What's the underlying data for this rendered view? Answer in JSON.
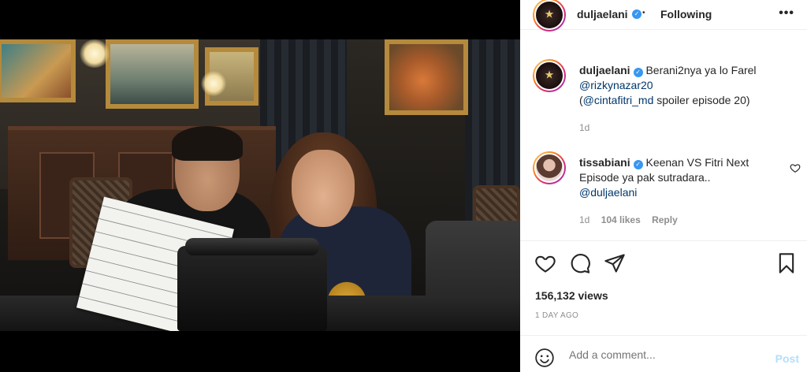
{
  "post": {
    "author": "duljaelani",
    "follow_status": "Following",
    "separator": "•",
    "more_label": "•••"
  },
  "comments": [
    {
      "username": "duljaelani",
      "text_main": "Berani2nya ya lo Farel",
      "mention_1": "@rizkynazar20",
      "text_paren_open": "(",
      "mention_2": "@cintafitri_md",
      "text_rest": " spoiler episode 20)",
      "age": "1d"
    },
    {
      "username": "tissabiani",
      "text_main": "Keenan VS Fitri Next Episode ya pak sutradara..",
      "mention": "@duljaelani",
      "age": "1d",
      "likes": "104 likes",
      "reply": "Reply"
    }
  ],
  "stats": {
    "views": "156,132 views",
    "posted": "1 DAY AGO"
  },
  "add_comment": {
    "placeholder": "Add a comment...",
    "post_label": "Post"
  },
  "icons": {
    "like": "heart-icon",
    "comment": "comment-icon",
    "share": "paper-plane-icon",
    "save": "bookmark-icon",
    "emoji": "emoji-icon",
    "verified": "verified-badge-icon"
  },
  "colors": {
    "verified": "#3897f0",
    "post_button": "#b2dffc",
    "muted": "#8e8e8e",
    "mention": "#00376b"
  }
}
